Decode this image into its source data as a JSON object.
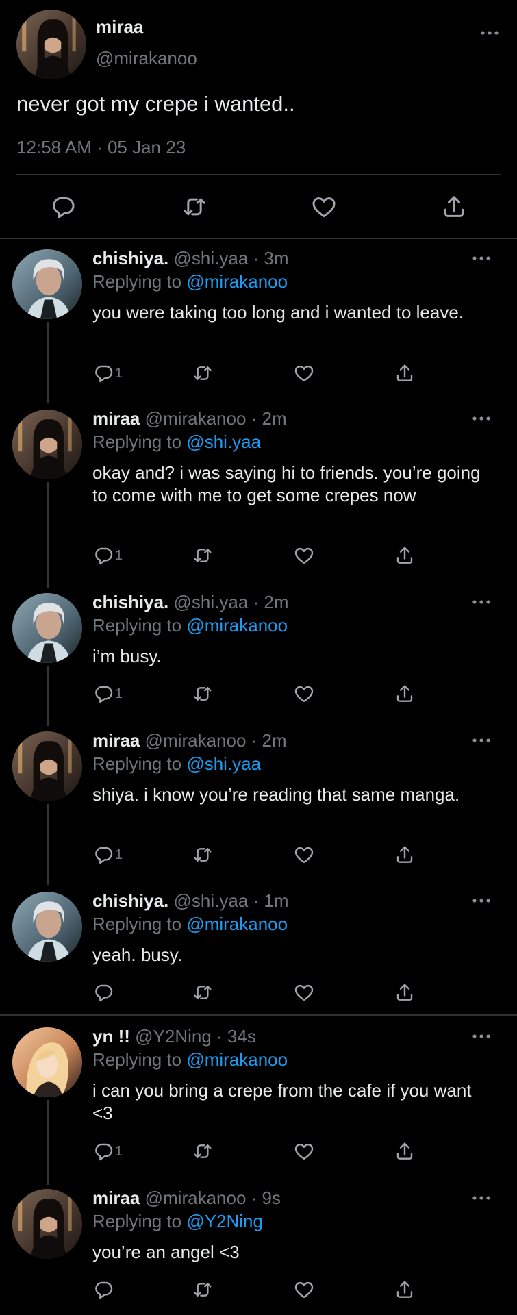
{
  "main_tweet": {
    "name": "miraa",
    "handle": "@mirakanoo",
    "text": "never got my crepe i wanted..",
    "timestamp": "12:58 AM · 05 Jan 23"
  },
  "icons": {
    "reply": "reply-icon",
    "retweet": "retweet-icon",
    "like": "heart-icon",
    "share": "share-icon",
    "more": "more-icon"
  },
  "colors": {
    "background": "#000000",
    "text": "#e7e9ea",
    "muted": "#71767b",
    "mention": "#1d9bf0",
    "divider": "#2f3336"
  },
  "replies": [
    {
      "name": "chishiya.",
      "meta": "@shi.yaa · 3m",
      "replying_label": "Replying to",
      "replying_to": "@mirakanoo",
      "text": "you were taking too long and i wanted to leave.",
      "reply_count": "1"
    },
    {
      "name": "miraa",
      "meta": "@mirakanoo · 2m",
      "replying_label": "Replying to",
      "replying_to": "@shi.yaa",
      "text": "okay and? i was saying hi to friends. you’re going to come with me to get some crepes now",
      "reply_count": "1"
    },
    {
      "name": "chishiya.",
      "meta": "@shi.yaa · 2m",
      "replying_label": "Replying to",
      "replying_to": "@mirakanoo",
      "text": "i’m busy.",
      "reply_count": "1"
    },
    {
      "name": "miraa",
      "meta": "@mirakanoo · 2m",
      "replying_label": "Replying to",
      "replying_to": "@shi.yaa",
      "text": "shiya. i know you’re reading that same manga.",
      "reply_count": "1"
    },
    {
      "name": "chishiya.",
      "meta": "@shi.yaa · 1m",
      "replying_label": "Replying to",
      "replying_to": "@mirakanoo",
      "text": "yeah. busy.",
      "reply_count": ""
    },
    {
      "name": "yn !!",
      "meta": "@Y2Ning · 34s",
      "replying_label": "Replying to",
      "replying_to": "@mirakanoo",
      "text": "i can you bring a crepe from the cafe if you want <3",
      "reply_count": "1"
    },
    {
      "name": "miraa",
      "meta": "@mirakanoo · 9s",
      "replying_label": "Replying to",
      "replying_to": "@Y2Ning",
      "text": "you’re an angel <3",
      "reply_count": ""
    }
  ]
}
